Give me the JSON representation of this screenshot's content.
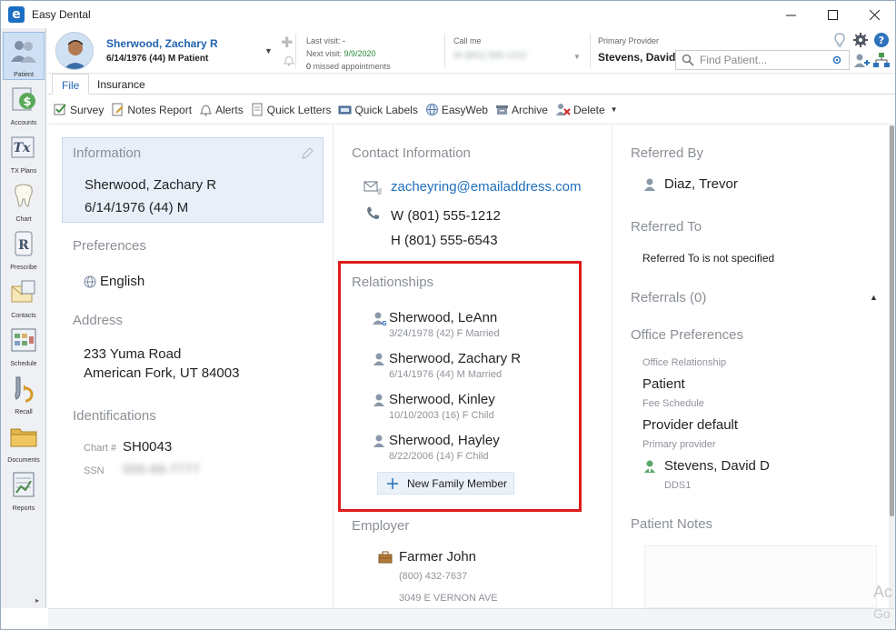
{
  "window": {
    "title": "Easy Dental",
    "logo_letter": "e"
  },
  "nav": {
    "items": [
      {
        "label": "Patient"
      },
      {
        "label": "Accounts"
      },
      {
        "label": "TX Plans"
      },
      {
        "label": "Chart"
      },
      {
        "label": "Prescribe"
      },
      {
        "label": "Contacts"
      },
      {
        "label": "Schedule"
      },
      {
        "label": "Recall"
      },
      {
        "label": "Documents"
      },
      {
        "label": "Reports"
      }
    ]
  },
  "header": {
    "patient_name": "Sherwood, Zachary R",
    "patient_sub": "6/14/1976 (44) M Patient",
    "last_visit_label": "Last visit:",
    "last_visit_value": "-",
    "next_visit_label": "Next visit:",
    "next_visit_value": "9/9/2020",
    "missed_count": "0",
    "missed_label": "missed appointments",
    "call_me_label": "Call me",
    "call_me_value": "W (801) 555-1212",
    "primary_provider_label": "Primary Provider",
    "primary_provider_value": "Stevens, David",
    "find_placeholder": "Find Patient..."
  },
  "tabs": [
    {
      "label": "File"
    },
    {
      "label": "Insurance"
    }
  ],
  "toolbar": {
    "survey": "Survey",
    "notes_report": "Notes Report",
    "alerts": "Alerts",
    "quick_letters": "Quick Letters",
    "quick_labels": "Quick Labels",
    "easyweb": "EasyWeb",
    "archive": "Archive",
    "delete": "Delete"
  },
  "information": {
    "title": "Information",
    "name": "Sherwood, Zachary R",
    "dob": "6/14/1976 (44) M"
  },
  "preferences": {
    "title": "Preferences",
    "language": "English"
  },
  "address": {
    "title": "Address",
    "line1": "233 Yuma Road",
    "line2": "American Fork, UT 84003"
  },
  "identifications": {
    "title": "Identifications",
    "chart_label": "Chart #",
    "chart_value": "SH0043",
    "ssn_label": "SSN",
    "ssn_value": "555-66-7777"
  },
  "contact": {
    "title": "Contact Information",
    "email": "zacheyring@emailaddress.com",
    "phone_work": "W (801) 555-1212",
    "phone_home": "H (801) 555-6543"
  },
  "relationships": {
    "title": "Relationships",
    "members": [
      {
        "name": "Sherwood, LeAnn",
        "detail": "3/24/1978 (42) F Married"
      },
      {
        "name": "Sherwood, Zachary R",
        "detail": "6/14/1976 (44) M Married"
      },
      {
        "name": "Sherwood, Kinley",
        "detail": "10/10/2003 (16) F Child"
      },
      {
        "name": "Sherwood, Hayley",
        "detail": "8/22/2006 (14) F Child"
      }
    ],
    "new_member_label": "New Family Member"
  },
  "employer": {
    "title": "Employer",
    "name": "Farmer John",
    "phone": "(800) 432-7637",
    "address": "3049 E VERNON AVE"
  },
  "referred_by": {
    "title": "Referred By",
    "name": "Diaz, Trevor"
  },
  "referred_to": {
    "title": "Referred To",
    "value": "Referred To is not specified"
  },
  "referrals": {
    "title": "Referrals (0)"
  },
  "office_preferences": {
    "title": "Office Preferences",
    "relationship_label": "Office Relationship",
    "relationship_value": "Patient",
    "fee_label": "Fee Schedule",
    "fee_value": "Provider default",
    "provider_label": "Primary provider",
    "provider_value": "Stevens, David D",
    "provider_id": "DDS1"
  },
  "patient_notes": {
    "title": "Patient Notes"
  },
  "watermark": {
    "line1": "Ac",
    "line2": "Go"
  }
}
